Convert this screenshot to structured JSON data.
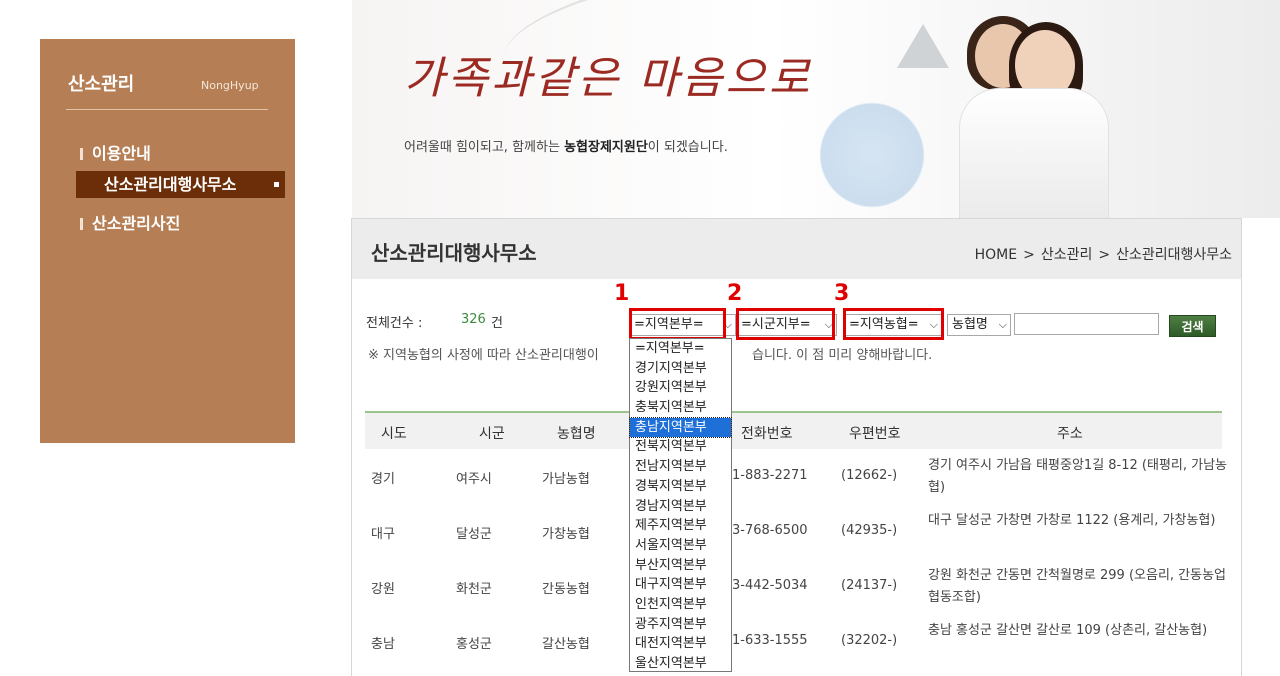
{
  "sidebar": {
    "title": "산소관리",
    "subtitle": "NongHyup",
    "items": [
      {
        "label": "이용안내"
      },
      {
        "label": "산소관리대행사무소"
      },
      {
        "label": "산소관리사진"
      }
    ]
  },
  "banner": {
    "headline": "가족과같은 마음으로",
    "subline_pre": "어려울때 힘이되고, 함께하는 ",
    "subline_bold": "농협장제지원단",
    "subline_post": "이 되겠습니다."
  },
  "page": {
    "title": "산소관리대행사무소",
    "breadcrumb": [
      "HOME",
      "산소관리",
      "산소관리대행사무소"
    ],
    "breadcrumb_sep": ">"
  },
  "filters": {
    "count_label": "전체건수 :",
    "count_value": "326",
    "count_unit": "건",
    "region": "=지역본부=",
    "city": "=시군지부=",
    "branch": "=지역농협=",
    "name": "농협명",
    "search_value": "",
    "search_button": "검색",
    "notice": "※ 지역농협의 사정에 따라 산소관리대행이",
    "notice_tail": "습니다. 이 점 미리 양해바랍니다."
  },
  "annotations": [
    "1",
    "2",
    "3"
  ],
  "dropdown": {
    "options": [
      "=지역본부=",
      "경기지역본부",
      "강원지역본부",
      "충북지역본부",
      "충남지역본부",
      "전북지역본부",
      "전남지역본부",
      "경북지역본부",
      "경남지역본부",
      "제주지역본부",
      "서울지역본부",
      "부산지역본부",
      "대구지역본부",
      "인천지역본부",
      "광주지역본부",
      "대전지역본부",
      "울산지역본부"
    ],
    "highlighted": "충남지역본부"
  },
  "table": {
    "headers": [
      "시도",
      "시군",
      "농협명",
      "전화번호",
      "우편번호",
      "주소"
    ],
    "rows": [
      {
        "sido": "경기",
        "sigun": "여주시",
        "nh": "가남농협",
        "tel": "1-883-2271",
        "zip": "(12662-)",
        "addr": "경기 여주시 가남읍 태평중앙1길 8-12 (태평리, 가남농협)"
      },
      {
        "sido": "대구",
        "sigun": "달성군",
        "nh": "가창농협",
        "tel": "3-768-6500",
        "zip": "(42935-)",
        "addr": "대구 달성군 가창면 가창로 1122 (용계리, 가창농협)"
      },
      {
        "sido": "강원",
        "sigun": "화천군",
        "nh": "간동농협",
        "tel": "3-442-5034",
        "zip": "(24137-)",
        "addr": "강원 화천군 간동면 간척월명로 299 (오음리, 간동농업협동조합)"
      },
      {
        "sido": "충남",
        "sigun": "홍성군",
        "nh": "갈산농협",
        "tel": "1-633-1555",
        "zip": "(32202-)",
        "addr": "충남 홍성군 갈산면 갈산로 109 (상촌리, 갈산농협)"
      }
    ]
  },
  "colors": {
    "sidebar_bg": "#b67e55",
    "sidebar_active": "#6c2e08",
    "annotation_red": "#e00000",
    "count_green": "#3d8a3d",
    "dropdown_highlight": "#1e6fd8"
  }
}
